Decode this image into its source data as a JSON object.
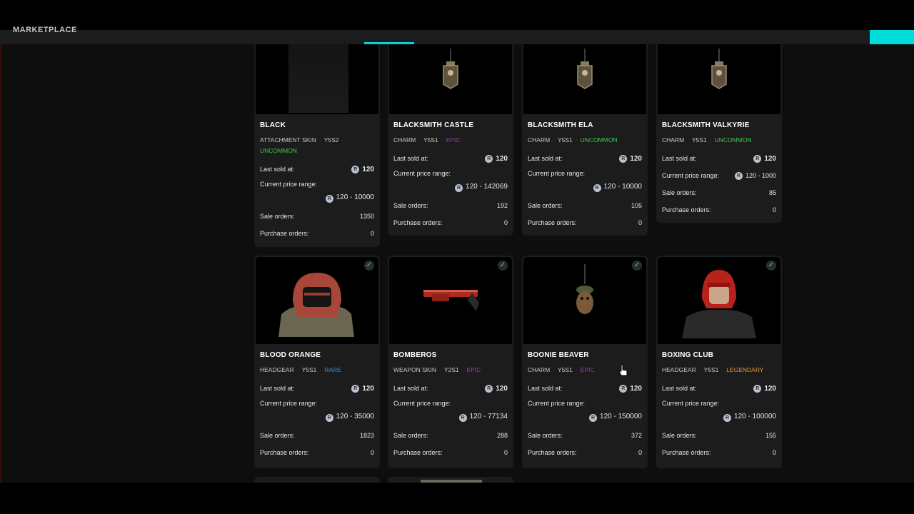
{
  "header": {
    "logo_text": "MARKETPLACE"
  },
  "labels": {
    "last_sold": "Last sold at:",
    "price_range": "Current price range:",
    "sale_orders": "Sale orders:",
    "purchase_orders": "Purchase orders:",
    "coin_symbol": "R"
  },
  "cards": [
    {
      "title": "BLACK",
      "type": "ATTACHMENT SKIN",
      "season": "Y5S2",
      "rarity": "UNCOMMON",
      "last_sold": "120",
      "range": "120 - 10000",
      "sale": "1350",
      "purchase": "0"
    },
    {
      "title": "BLACKSMITH CASTLE",
      "type": "CHARM",
      "season": "Y5S1",
      "rarity": "EPIC",
      "last_sold": "120",
      "range": "120 - 142069",
      "sale": "192",
      "purchase": "0"
    },
    {
      "title": "BLACKSMITH ELA",
      "type": "CHARM",
      "season": "Y5S1",
      "rarity": "UNCOMMON",
      "last_sold": "120",
      "range": "120 - 10000",
      "sale": "105",
      "purchase": "0"
    },
    {
      "title": "BLACKSMITH VALKYRIE",
      "type": "CHARM",
      "season": "Y5S1",
      "rarity": "UNCOMMON",
      "last_sold": "120",
      "range": "120 - 1000",
      "sale": "85",
      "purchase": "0"
    },
    {
      "title": "BLOOD ORANGE",
      "type": "HEADGEAR",
      "season": "Y5S1",
      "rarity": "RARE",
      "last_sold": "120",
      "range": "120 - 35000",
      "sale": "1823",
      "purchase": "0"
    },
    {
      "title": "BOMBEROS",
      "type": "WEAPON SKIN",
      "season": "Y2S1",
      "rarity": "EPIC",
      "last_sold": "120",
      "range": "120 - 77134",
      "sale": "288",
      "purchase": "0"
    },
    {
      "title": "BOONIE BEAVER",
      "type": "CHARM",
      "season": "Y5S1",
      "rarity": "EPIC",
      "last_sold": "120",
      "range": "120 - 150000",
      "sale": "372",
      "purchase": "0"
    },
    {
      "title": "BOXING CLUB",
      "type": "HEADGEAR",
      "season": "Y5S1",
      "rarity": "LEGENDARY",
      "last_sold": "120",
      "range": "120 - 100000",
      "sale": "155",
      "purchase": "0"
    }
  ],
  "icons": {
    "check": "check-icon",
    "coin": "credits-coin-icon",
    "cursor": "hand-cursor-icon"
  },
  "colors": {
    "accent": "#00dedc",
    "uncommon": "#3fc74c",
    "epic": "#9a3bb8",
    "rare": "#3a8fd8",
    "legendary": "#e09a2a"
  }
}
